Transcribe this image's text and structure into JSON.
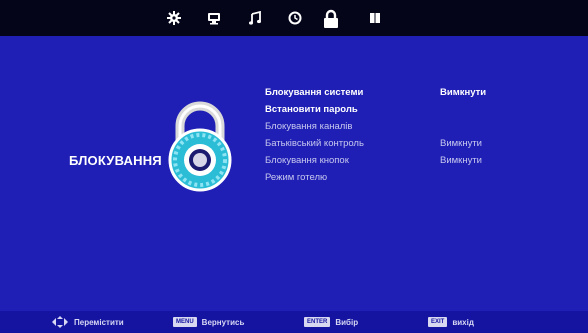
{
  "tabs": [
    {
      "icon": "picture-gear-icon",
      "name": "tab-picture"
    },
    {
      "icon": "monitor-icon",
      "name": "tab-screen"
    },
    {
      "icon": "music-note-icon",
      "name": "tab-sound"
    },
    {
      "icon": "clock-icon",
      "name": "tab-time"
    },
    {
      "icon": "lock-icon",
      "name": "tab-lock",
      "active": true
    },
    {
      "icon": "book-icon",
      "name": "tab-setup"
    }
  ],
  "section": {
    "title": "БЛОКУВАННЯ"
  },
  "menu": [
    {
      "label": "Блокування системи",
      "value": "Вимкнути",
      "highlight": true
    },
    {
      "label": "Встановити пароль",
      "value": "",
      "highlight": true
    },
    {
      "label": "Блокування каналів",
      "value": "",
      "highlight": false
    },
    {
      "label": "Батьківський контроль",
      "value": "Вимкнути",
      "highlight": false
    },
    {
      "label": "Блокування кнопок",
      "value": "Вимкнути",
      "highlight": false
    },
    {
      "label": "Режим готелю",
      "value": "",
      "highlight": false
    }
  ],
  "footer": {
    "move": {
      "label": "Перемістити"
    },
    "back": {
      "key": "MENU",
      "label": "Вернутись"
    },
    "select": {
      "key": "ENTER",
      "label": "Вибір"
    },
    "exit": {
      "key": "EXIT",
      "label": "вихід"
    }
  },
  "colors": {
    "background": "#1f1fb6",
    "topbar": "#05051a",
    "accent_cyan": "#2bbcd6"
  }
}
